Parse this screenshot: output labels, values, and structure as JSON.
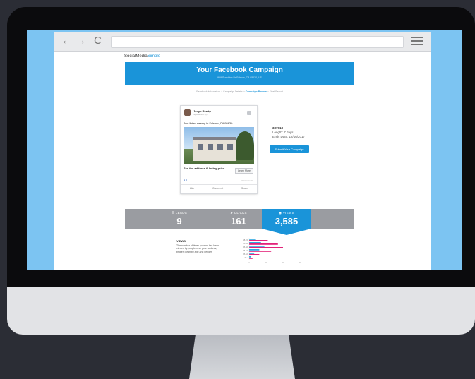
{
  "browser": {
    "back_glyph": "←",
    "forward_glyph": "→",
    "reload_glyph": "C"
  },
  "page": {
    "logo_prefix": "SocialMedia",
    "logo_suffix": "Simple",
    "title": "Your Facebook Campaign",
    "subtitle": "999 Sunshine Dr Folsom, CA 95630, US",
    "steps": [
      "Facebook Information",
      "Campaign Details",
      "Campaign Review",
      "Final Report"
    ],
    "active_step": "Campaign Review"
  },
  "post": {
    "name": "Jadyn Realty",
    "sponsored": "Sponsored · ⛭",
    "text": "Just listed nearby in Folsom, CA 95630",
    "cta_title": "See the address & listing price",
    "learn_more": "Learn More",
    "reaction_count": "3",
    "comments": "2 Comments",
    "actions": [
      "Like",
      "Comment",
      "Share"
    ]
  },
  "details": {
    "id": "337913",
    "length": "Length: 7 days",
    "ends": "Ends Date: 12/16/2017",
    "launch": "Submit Your Campaign"
  },
  "stats": [
    {
      "label": "LEADS",
      "value": "9",
      "icon": "list-icon"
    },
    {
      "label": "CLICKS",
      "value": "161",
      "icon": "cursor-icon"
    },
    {
      "label": "VIEWS",
      "value": "3,585",
      "icon": "eye-icon"
    }
  ],
  "views_note": {
    "heading": "VIEWS",
    "body": "The number of times your ad has been viewed by people near your address, broken down by age and gender"
  },
  "colors": {
    "accent": "#1a94d9",
    "female": "#e2247a",
    "male": "#2ea8df"
  },
  "chart_data": {
    "type": "bar",
    "orientation": "horizontal",
    "categories": [
      "18-24",
      "25-34",
      "35-44",
      "45-54",
      "55-64",
      "65+"
    ],
    "series": [
      {
        "name": "",
        "values": [
          8,
          14,
          18,
          12,
          6,
          2
        ]
      },
      {
        "name": "",
        "values": [
          22,
          34,
          40,
          26,
          12,
          4
        ]
      }
    ],
    "xlim": [
      0,
      60
    ]
  }
}
